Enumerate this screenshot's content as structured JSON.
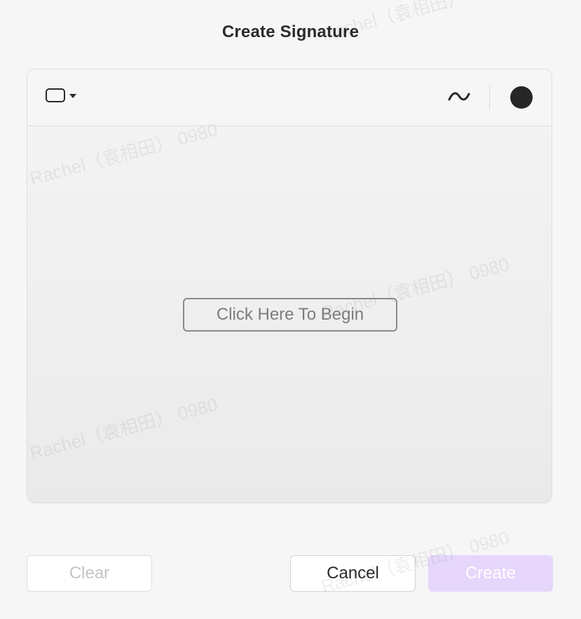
{
  "dialog": {
    "title": "Create Signature"
  },
  "toolbar": {
    "shape_icon": "rounded-rectangle-icon",
    "dropdown_icon": "caret-down-icon",
    "stroke_icon": "tilde-stroke-icon",
    "color_swatch": {
      "color": "#262626"
    }
  },
  "canvas": {
    "begin_label": "Click Here To Begin"
  },
  "footer": {
    "clear_label": "Clear",
    "cancel_label": "Cancel",
    "create_label": "Create"
  },
  "colors": {
    "accent_disabled": "#e6d6fb",
    "background": "#f6f6f6"
  },
  "watermark": {
    "text": "Rachel（袁相田） 0980"
  }
}
